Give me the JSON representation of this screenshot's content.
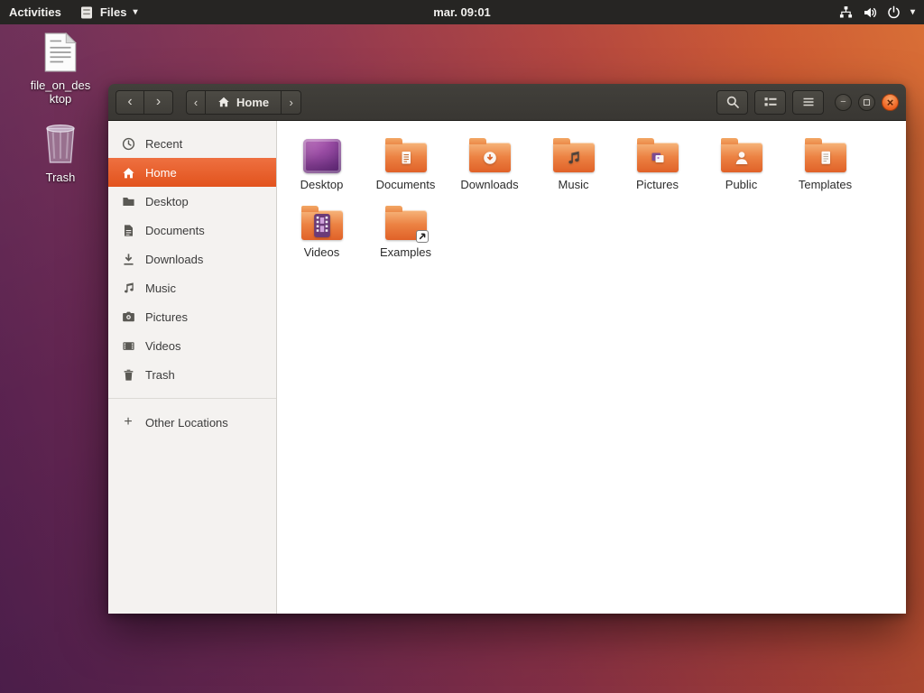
{
  "colors": {
    "accent": "#e95420",
    "close_button": "#ee6220",
    "topbar_bg": "#262523",
    "headerbar_bg": "#3a3833",
    "sidebar_bg": "#f4f2f0"
  },
  "top_bar": {
    "activities_label": "Activities",
    "app_name": "Files",
    "clock": "mar. 09:01"
  },
  "desktop": {
    "file_icon_label": "file_on_desktop",
    "trash_label": "Trash"
  },
  "window": {
    "header": {
      "back": "‹",
      "forward": "›",
      "path_prev": "‹",
      "path_current": "Home",
      "path_next": "›",
      "minimize": "−",
      "close": "×"
    },
    "sidebar": {
      "items": [
        {
          "label": "Recent",
          "icon": "recent-icon",
          "selected": false
        },
        {
          "label": "Home",
          "icon": "home-icon",
          "selected": true
        },
        {
          "label": "Desktop",
          "icon": "folder-icon",
          "selected": false
        },
        {
          "label": "Documents",
          "icon": "documents-icon",
          "selected": false
        },
        {
          "label": "Downloads",
          "icon": "downloads-icon",
          "selected": false
        },
        {
          "label": "Music",
          "icon": "music-icon",
          "selected": false
        },
        {
          "label": "Pictures",
          "icon": "pictures-icon",
          "selected": false
        },
        {
          "label": "Videos",
          "icon": "videos-icon",
          "selected": false
        },
        {
          "label": "Trash",
          "icon": "trash-icon",
          "selected": false
        }
      ],
      "other_locations_label": "Other Locations"
    },
    "files": [
      {
        "label": "Desktop",
        "kind": "desktop"
      },
      {
        "label": "Documents",
        "kind": "documents"
      },
      {
        "label": "Downloads",
        "kind": "downloads"
      },
      {
        "label": "Music",
        "kind": "music"
      },
      {
        "label": "Pictures",
        "kind": "pictures"
      },
      {
        "label": "Public",
        "kind": "public"
      },
      {
        "label": "Templates",
        "kind": "templates"
      },
      {
        "label": "Videos",
        "kind": "videos"
      },
      {
        "label": "Examples",
        "kind": "examples"
      }
    ]
  }
}
